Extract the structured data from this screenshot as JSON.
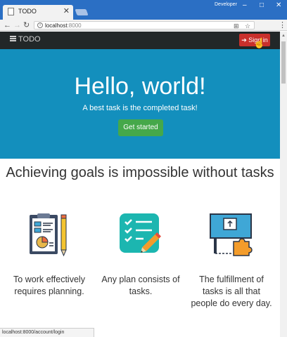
{
  "browser": {
    "tab_title": "TODO",
    "tab_close": "✕",
    "profile_name": "Developer",
    "controls": {
      "minimize": "–",
      "maximize": "□",
      "close": "✕"
    },
    "nav": {
      "back": "←",
      "forward": "→",
      "reload": "↻"
    },
    "url_host": "localhost",
    "url_port": ":8000",
    "info_glyph": "i",
    "bookmark_glyph": "☆",
    "translate_glyph": "⊞",
    "menu_glyph": "⋮",
    "status_url": "localhost:8000/account/login"
  },
  "navbar": {
    "brand": "TODO",
    "signin_label": "Sign in",
    "signin_icon": "➔"
  },
  "hero": {
    "title": "Hello, world!",
    "subtitle": "A best task is the completed task!",
    "button": "Get started"
  },
  "section": {
    "title": "Achieving goals is impossible without tasks"
  },
  "features": [
    {
      "icon": "planning-clipboard-icon",
      "caption": "To work effectively requires planning."
    },
    {
      "icon": "checklist-pencil-icon",
      "caption": "Any plan consists of tasks."
    },
    {
      "icon": "puzzle-board-icon",
      "caption": "The fulfillment of tasks is all that people do every day."
    }
  ],
  "colors": {
    "hero_bg": "#138fbd",
    "navbar_bg": "#222728",
    "signin_bg": "#c9302c",
    "button_bg": "#45a84a",
    "chrome_blue": "#2b6fc4"
  }
}
